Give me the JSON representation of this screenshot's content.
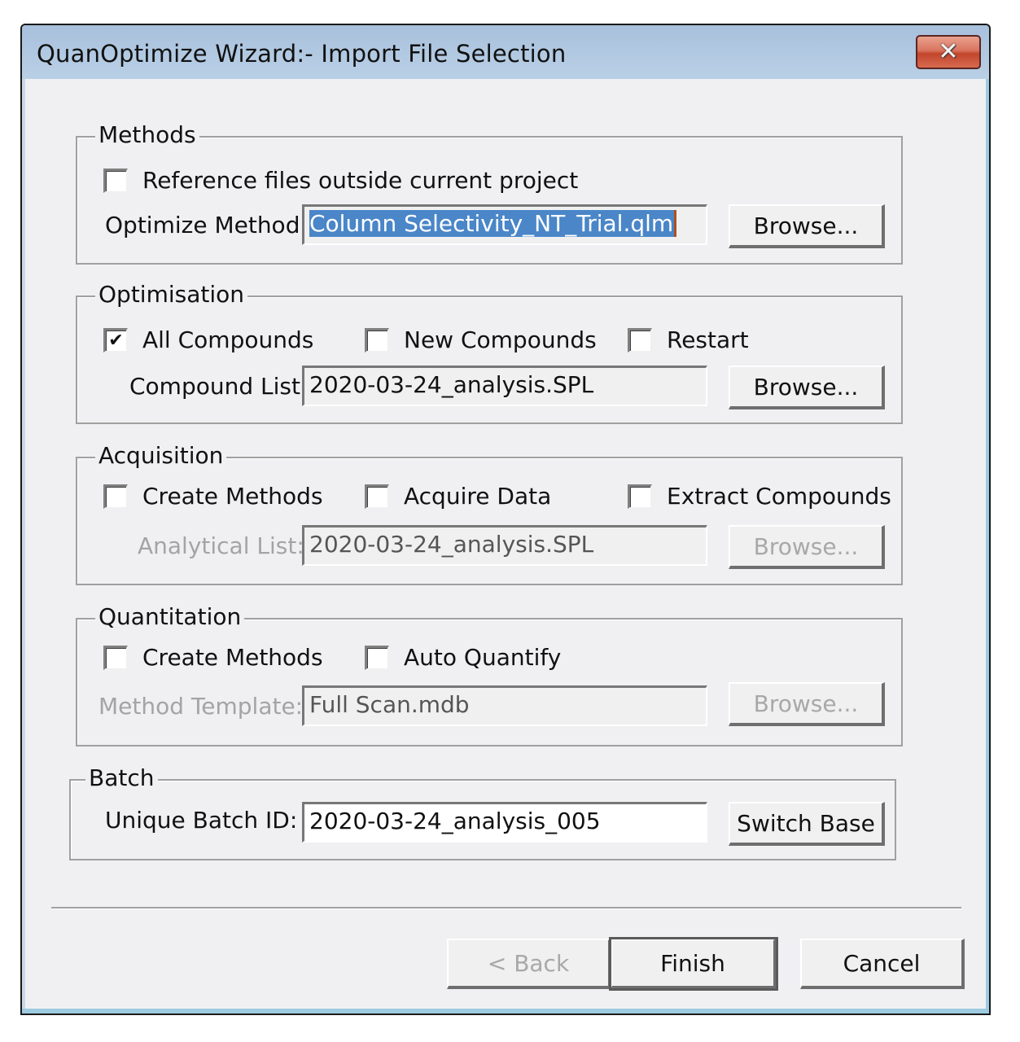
{
  "window": {
    "title": "QuanOptimize Wizard:- Import File Selection",
    "close_icon": "close-x-icon"
  },
  "methods": {
    "legend": "Methods",
    "reference_outside": {
      "label": "Reference files outside current project",
      "checked": false
    },
    "optimize_method_label": "Optimize Method:",
    "optimize_method_value": "Column Selectivity_NT_Trial.qlm",
    "browse_label": "Browse..."
  },
  "optimisation": {
    "legend": "Optimisation",
    "all_compounds": {
      "label": "All Compounds",
      "checked": true
    },
    "new_compounds": {
      "label": "New Compounds",
      "checked": false
    },
    "restart": {
      "label": "Restart",
      "checked": false
    },
    "compound_list_label": "Compound List:",
    "compound_list_value": "2020-03-24_analysis.SPL",
    "browse_label": "Browse..."
  },
  "acquisition": {
    "legend": "Acquisition",
    "create_methods": {
      "label": "Create Methods",
      "checked": false
    },
    "acquire_data": {
      "label": "Acquire Data",
      "checked": false
    },
    "extract_compounds": {
      "label": "Extract Compounds",
      "checked": false
    },
    "analytical_list_label": "Analytical List:",
    "analytical_list_value": "2020-03-24_analysis.SPL",
    "browse_label": "Browse..."
  },
  "quantitation": {
    "legend": "Quantitation",
    "create_methods": {
      "label": "Create Methods",
      "checked": false
    },
    "auto_quantify": {
      "label": "Auto Quantify",
      "checked": false
    },
    "method_template_label": "Method Template:",
    "method_template_value": "Full Scan.mdb",
    "browse_label": "Browse..."
  },
  "batch": {
    "legend": "Batch",
    "unique_batch_id_label": "Unique Batch ID:",
    "unique_batch_id_value": "2020-03-24_analysis_005",
    "switch_base_label": "Switch Base"
  },
  "footer": {
    "back_label": "< Back",
    "finish_label": "Finish",
    "cancel_label": "Cancel"
  },
  "check_glyph": "✔"
}
